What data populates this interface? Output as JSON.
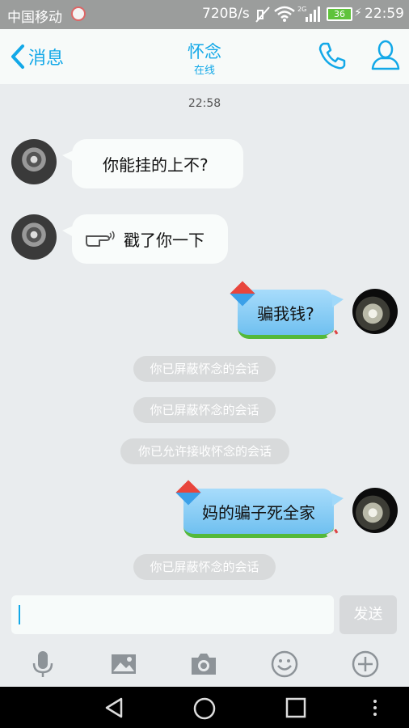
{
  "status_bar": {
    "carrier": "中国移动",
    "net_speed": "720B/s",
    "network_type": "2G",
    "battery": "36",
    "time": "22:59"
  },
  "header": {
    "back_label": "消息",
    "title": "怀念",
    "subtitle": "在线"
  },
  "conversation": {
    "timestamp": "22:58",
    "messages": [
      {
        "side": "left",
        "text": "你能挂的上不?"
      },
      {
        "side": "left",
        "text": "戳了你一下",
        "icon": "poke-hand-icon"
      },
      {
        "side": "right",
        "text": "骗我钱?"
      },
      {
        "side": "system",
        "text": "你已屏蔽怀念的会话"
      },
      {
        "side": "system",
        "text": "你已屏蔽怀念的会话"
      },
      {
        "side": "system",
        "text": "你已允许接收怀念的会话"
      },
      {
        "side": "right",
        "text": "妈的骗子死全家"
      },
      {
        "side": "system",
        "text": "你已屏蔽怀念的会话"
      }
    ]
  },
  "composer": {
    "input_value": "",
    "send_label": "发送"
  },
  "toolbar": [
    "microphone-icon",
    "image-icon",
    "camera-icon",
    "emoji-icon",
    "plus-icon"
  ],
  "colors": {
    "accent": "#12a8e8",
    "background": "#e9ecee",
    "system_pill": "#d8dadb"
  }
}
